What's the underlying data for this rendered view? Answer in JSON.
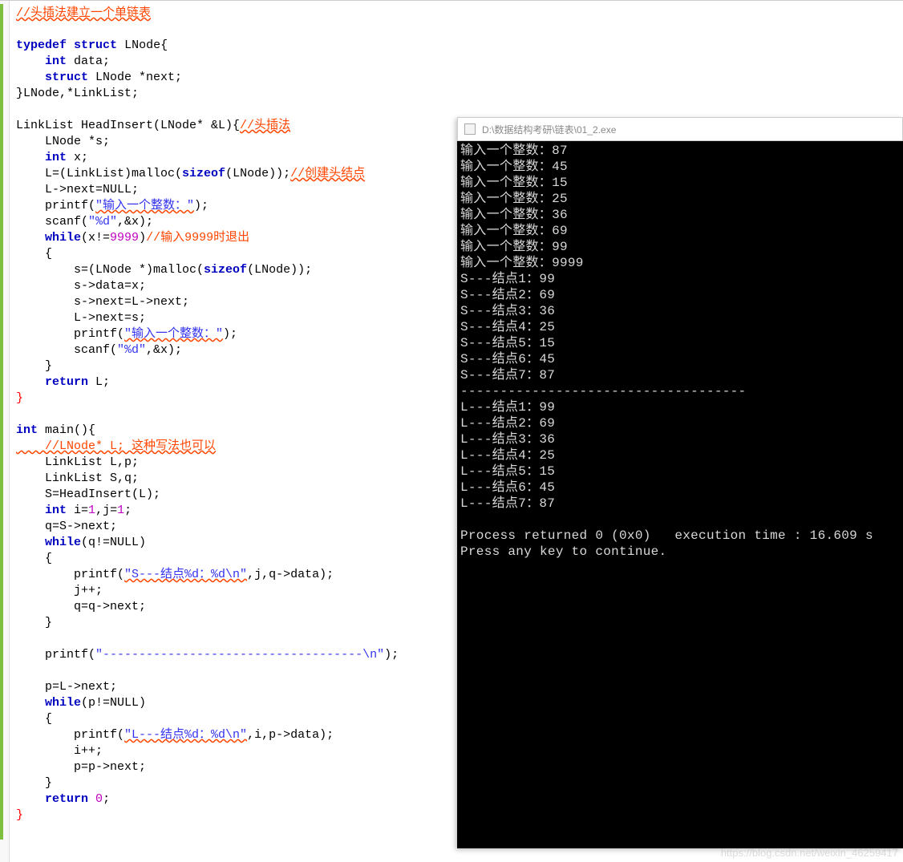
{
  "editor": {
    "comment_top": "//头插法建立一个单链表",
    "typedef_kw": "typedef",
    "struct_kw": "struct",
    "lnode": "LNode",
    "open_brace": "{",
    "int_kw": "int",
    "data_member": " data;",
    "struct_kw2": "struct",
    "lnode2": " LNode ",
    "next_member": "*next;",
    "close_struct": "}LNode,*LinkList;",
    "fn_decl_1": "LinkList HeadInsert(LNode* &L){",
    "cmt_headinsert": "//头插法",
    "line_s": "    LNode *s;",
    "int_x": "    ",
    "int_x_kw": "int",
    "int_x_rest": " x;",
    "malloc_line": "    L=(LinkList)malloc(",
    "sizeof_kw": "sizeof",
    "malloc_rest": "(LNode));",
    "cmt_create": "//创建头结点",
    "l_next_null": "    L->next=NULL;",
    "printf1": "    printf(",
    "str_input": "\"输入一个整数：\"",
    "printf1_end": ");",
    "scanf1": "    scanf(",
    "scanf1_fmt": "\"%d\"",
    "scanf1_rest": ",&x);",
    "while_kw": "while",
    "while_cond": "(x!=",
    "num_9999": "9999",
    "while_close": ")",
    "cmt_9999": "//输入9999时退出",
    "open_b2": "    {",
    "malloc_s": "        s=(LNode *)malloc(",
    "malloc_s_rest": "(LNode));",
    "s_data": "        s->data=x;",
    "s_next": "        s->next=L->next;",
    "l_next_s": "        L->next=s;",
    "printf2": "        printf(",
    "printf2_end": ");",
    "scanf2": "        scanf(",
    "scanf2_rest": ",&x);",
    "close_b2": "    }",
    "return_kw": "return",
    "return_l": " L;",
    "close_fn": "}",
    "int_main": "int",
    "main_decl": " main(){",
    "cmt_lnode": "    //LNode* L; 这种写法也可以",
    "decl_lp": "    LinkList L,p;",
    "decl_sq": "    LinkList S,q;",
    "s_headinsert": "    S=HeadInsert(L);",
    "int_ij_pre": "    ",
    "int_ij": "int",
    "int_ij_rest": " i=",
    "num_1a": "1",
    "ij_mid": ",j=",
    "num_1b": "1",
    "ij_end": ";",
    "q_s_next": "    q=S->next;",
    "while2_cond": "(q!=NULL)",
    "open_b3": "    {",
    "printf3": "        printf(",
    "str_s_node": "\"S---结点%d：%d\\n\"",
    "printf3_rest": ",j,q->data);",
    "j_plus": "        j++;",
    "q_next": "        q=q->next;",
    "close_b3": "    }",
    "printf_dash": "    printf(",
    "str_dash": "\"------------------------------------\\n\"",
    "printf_dash_end": ");",
    "p_l_next": "    p=L->next;",
    "while3_cond": "(p!=NULL)",
    "open_b4": "    {",
    "printf4": "        printf(",
    "str_l_node": "\"L---结点%d：%d\\n\"",
    "printf4_rest": ",i,p->data);",
    "i_plus": "        i++;",
    "p_next": "        p=p->next;",
    "close_b4": "    }",
    "return0": " ",
    "num_0": "0",
    "semi": ";",
    "close_main": "}"
  },
  "console": {
    "title": "D:\\数据结构考研\\链表\\01_2.exe",
    "lines": [
      "输入一个整数：87",
      "输入一个整数：45",
      "输入一个整数：15",
      "输入一个整数：25",
      "输入一个整数：36",
      "输入一个整数：69",
      "输入一个整数：99",
      "输入一个整数：9999",
      "S---结点1：99",
      "S---结点2：69",
      "S---结点3：36",
      "S---结点4：25",
      "S---结点5：15",
      "S---结点6：45",
      "S---结点7：87",
      "------------------------------------",
      "L---结点1：99",
      "L---结点2：69",
      "L---结点3：36",
      "L---结点4：25",
      "L---结点5：15",
      "L---结点6：45",
      "L---结点7：87",
      "",
      "Process returned 0 (0x0)   execution time : 16.609 s",
      "Press any key to continue."
    ]
  },
  "watermark": "https://blog.csdn.net/weixin_46259417"
}
